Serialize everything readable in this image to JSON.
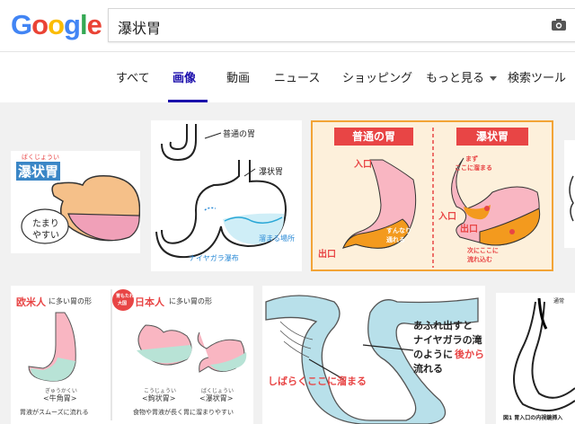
{
  "search": {
    "query": "瀑状胃"
  },
  "logo": {
    "letters": [
      "G",
      "o",
      "o",
      "g",
      "l",
      "e"
    ],
    "colors": [
      "#4285f4",
      "#ea4335",
      "#fbbc05",
      "#4285f4",
      "#34a853",
      "#ea4335"
    ]
  },
  "tabs": [
    {
      "label": "すべて"
    },
    {
      "label": "画像",
      "active": true
    },
    {
      "label": "動画"
    },
    {
      "label": "ニュース"
    },
    {
      "label": "ショッピング"
    },
    {
      "label": "もっと見る"
    },
    {
      "label": "検索ツール"
    }
  ],
  "results": {
    "r1": {
      "ruby": "ばくじょうい",
      "title": "瀑状胃",
      "bubble_l1": "たまり",
      "bubble_l2": "やすい"
    },
    "r2": {
      "l_normal": "普通の胃",
      "l_cascade": "瀑状胃",
      "l_water": "溜まる場所",
      "l_niagara": "ナイヤガラ瀑布"
    },
    "r3": {
      "h_normal": "普通の胃",
      "h_cascade": "瀑状胃",
      "in1": "入口",
      "out1": "出口",
      "note1a": "すんなり",
      "note1b": "通れる",
      "in2": "入口",
      "out2": "出口",
      "note2a": "まず",
      "note2b": "ここに溜まる",
      "note3a": "次にここに",
      "note3b": "流れ込む"
    },
    "r5": {
      "t_west": "欧米人",
      "t_west_rest": "に多い胃の形",
      "t_jp": "日本人",
      "t_jp_rest": "に多い胃の形",
      "badge1": "胃もたれ",
      "badge2": "大国",
      "ruby1": "ぎゅうかくい",
      "name1": "<牛角胃>",
      "ruby2": "こうじょうい",
      "name2": "<鉤状胃>",
      "ruby3": "ばくじょうい",
      "name3": "<瀑状胃>",
      "foot1": "胃液がスムーズに流れる",
      "foot2": "食物や胃液が長く胃に溜まりやすい"
    },
    "r6": {
      "a1": "あふれ出すと",
      "a2": "ナイヤガラの滝",
      "a3": "のように",
      "a4": "後から",
      "a5": "流れる",
      "b1": "しばらくここに溜まる"
    },
    "r7": {
      "c1": "図1 胃入口の内視鏡挿入",
      "c2": "通常"
    }
  },
  "colors": {
    "accent": "#1a0dab",
    "stomach_peach": "#f5c089",
    "stomach_pink": "#f0a0b8",
    "orange": "#f39a1e",
    "red": "#e84545"
  }
}
